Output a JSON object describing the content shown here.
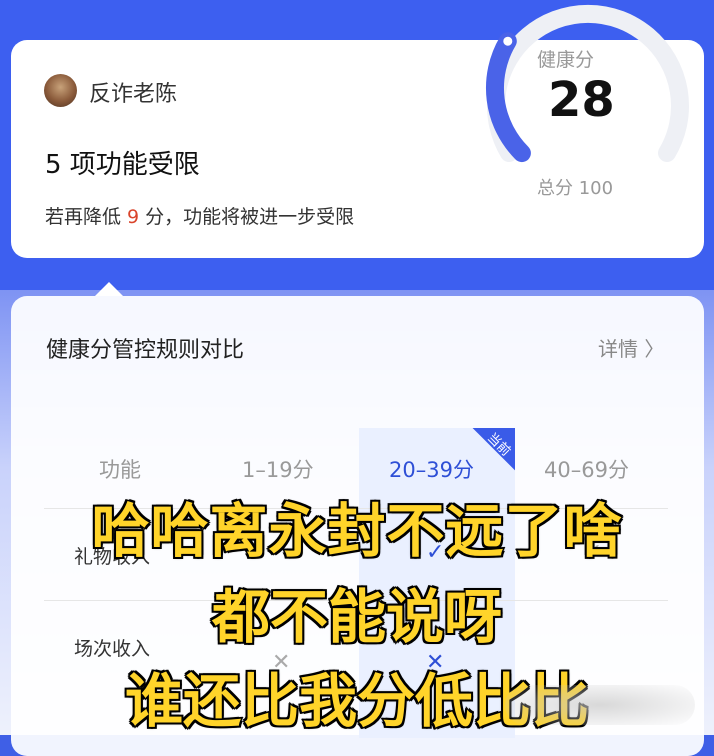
{
  "profile": {
    "username": "反诈老陈"
  },
  "status": {
    "title": "5 项功能受限",
    "sub_prefix": "若再降低 ",
    "sub_number": "9",
    "sub_suffix": " 分，功能将被进一步受限"
  },
  "score": {
    "label": "健康分",
    "value": "28",
    "total_text": "总分 100",
    "value_num": 28,
    "max_num": 100,
    "accent_color": "#4a63e8"
  },
  "rules": {
    "title": "健康分管控规则对比",
    "details_link": "详情 〉",
    "columns": [
      "功能",
      "1–19分",
      "20–39分",
      "40–69分"
    ],
    "current_badge": "当前",
    "rows": [
      {
        "label": "礼物收入",
        "marks": [
          "",
          "✓",
          "✓"
        ]
      },
      {
        "label": "场次收入",
        "marks": [
          "✕",
          "✕",
          ""
        ]
      }
    ]
  },
  "caption": {
    "line1": "哈哈离永封不远了啥",
    "line2": "都不能说呀",
    "line3": "谁还比我分低比比"
  }
}
